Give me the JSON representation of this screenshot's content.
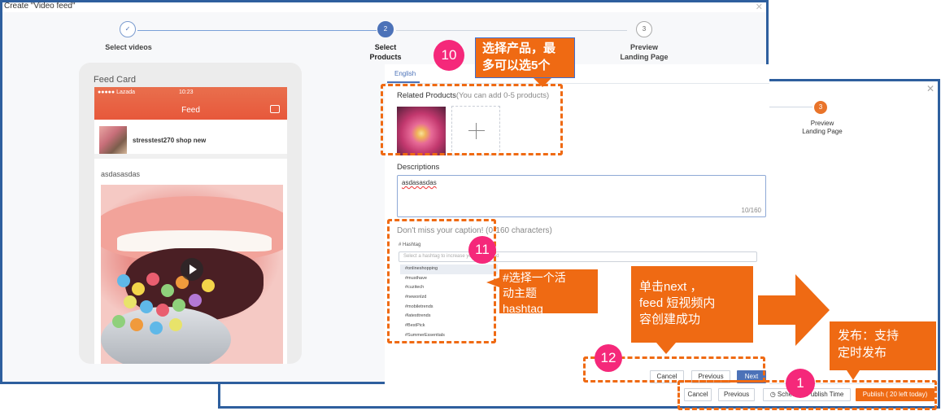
{
  "back_window": {
    "step_number": "3",
    "step_label": "Preview\nLanding Page",
    "buttons": {
      "cancel": "Cancel",
      "previous": "Previous",
      "schedule": "Schedule Publish Time",
      "publish": "Publish ( 20 left today)"
    }
  },
  "front_window": {
    "title": "Create \"Video feed\"",
    "steps": [
      {
        "label": "Select videos"
      },
      {
        "number": "2",
        "label": "Select\nProducts"
      },
      {
        "number": "3",
        "label": "Preview\nLanding Page"
      }
    ],
    "phone": {
      "feed_card_label": "Feed Card",
      "carrier": "●●●●● Lazada",
      "time": "10:23",
      "header_title": "Feed",
      "shop_name": "stresstest270 shop new",
      "description": "asdasasdas"
    },
    "form": {
      "tab_label": "English",
      "related_products_label": "Related Products",
      "related_products_hint": "(You can add 0-5 products)",
      "descriptions_label": "Descriptions",
      "descriptions_value": "asdasasdas",
      "descriptions_count": "10/160",
      "caption_label": "Don't miss your caption! (0-160 characters)",
      "hashtag_label": "# Hashtag",
      "hashtag_placeholder": "Select a hashtag to increase your reach and",
      "hashtags": [
        "#onlineshopping",
        "#musthave",
        "#cuzitech",
        "#newonlzd",
        "#mobiletrends",
        "#latesttrends",
        "#BestPick",
        "#SummerEssentials"
      ],
      "buttons": {
        "cancel": "Cancel",
        "previous": "Previous",
        "next": "Next"
      }
    }
  },
  "annotations": {
    "badge_10": "10",
    "badge_11": "11",
    "badge_12": "12",
    "badge_1": "1",
    "callout_products": "选择产品，最\n多可以选5个",
    "callout_hashtag": "#选择一个活\n动主题\nhashtag",
    "callout_next": "单击next ，\nfeed 短视频内\n容创建成功",
    "callout_publish": "发布：支持\n定时发布"
  },
  "colors": {
    "accent_blue": "#4c72b8",
    "annotation_orange": "#ef6a13",
    "badge_pink": "#f5287a",
    "window_border": "#2e5f9e"
  }
}
